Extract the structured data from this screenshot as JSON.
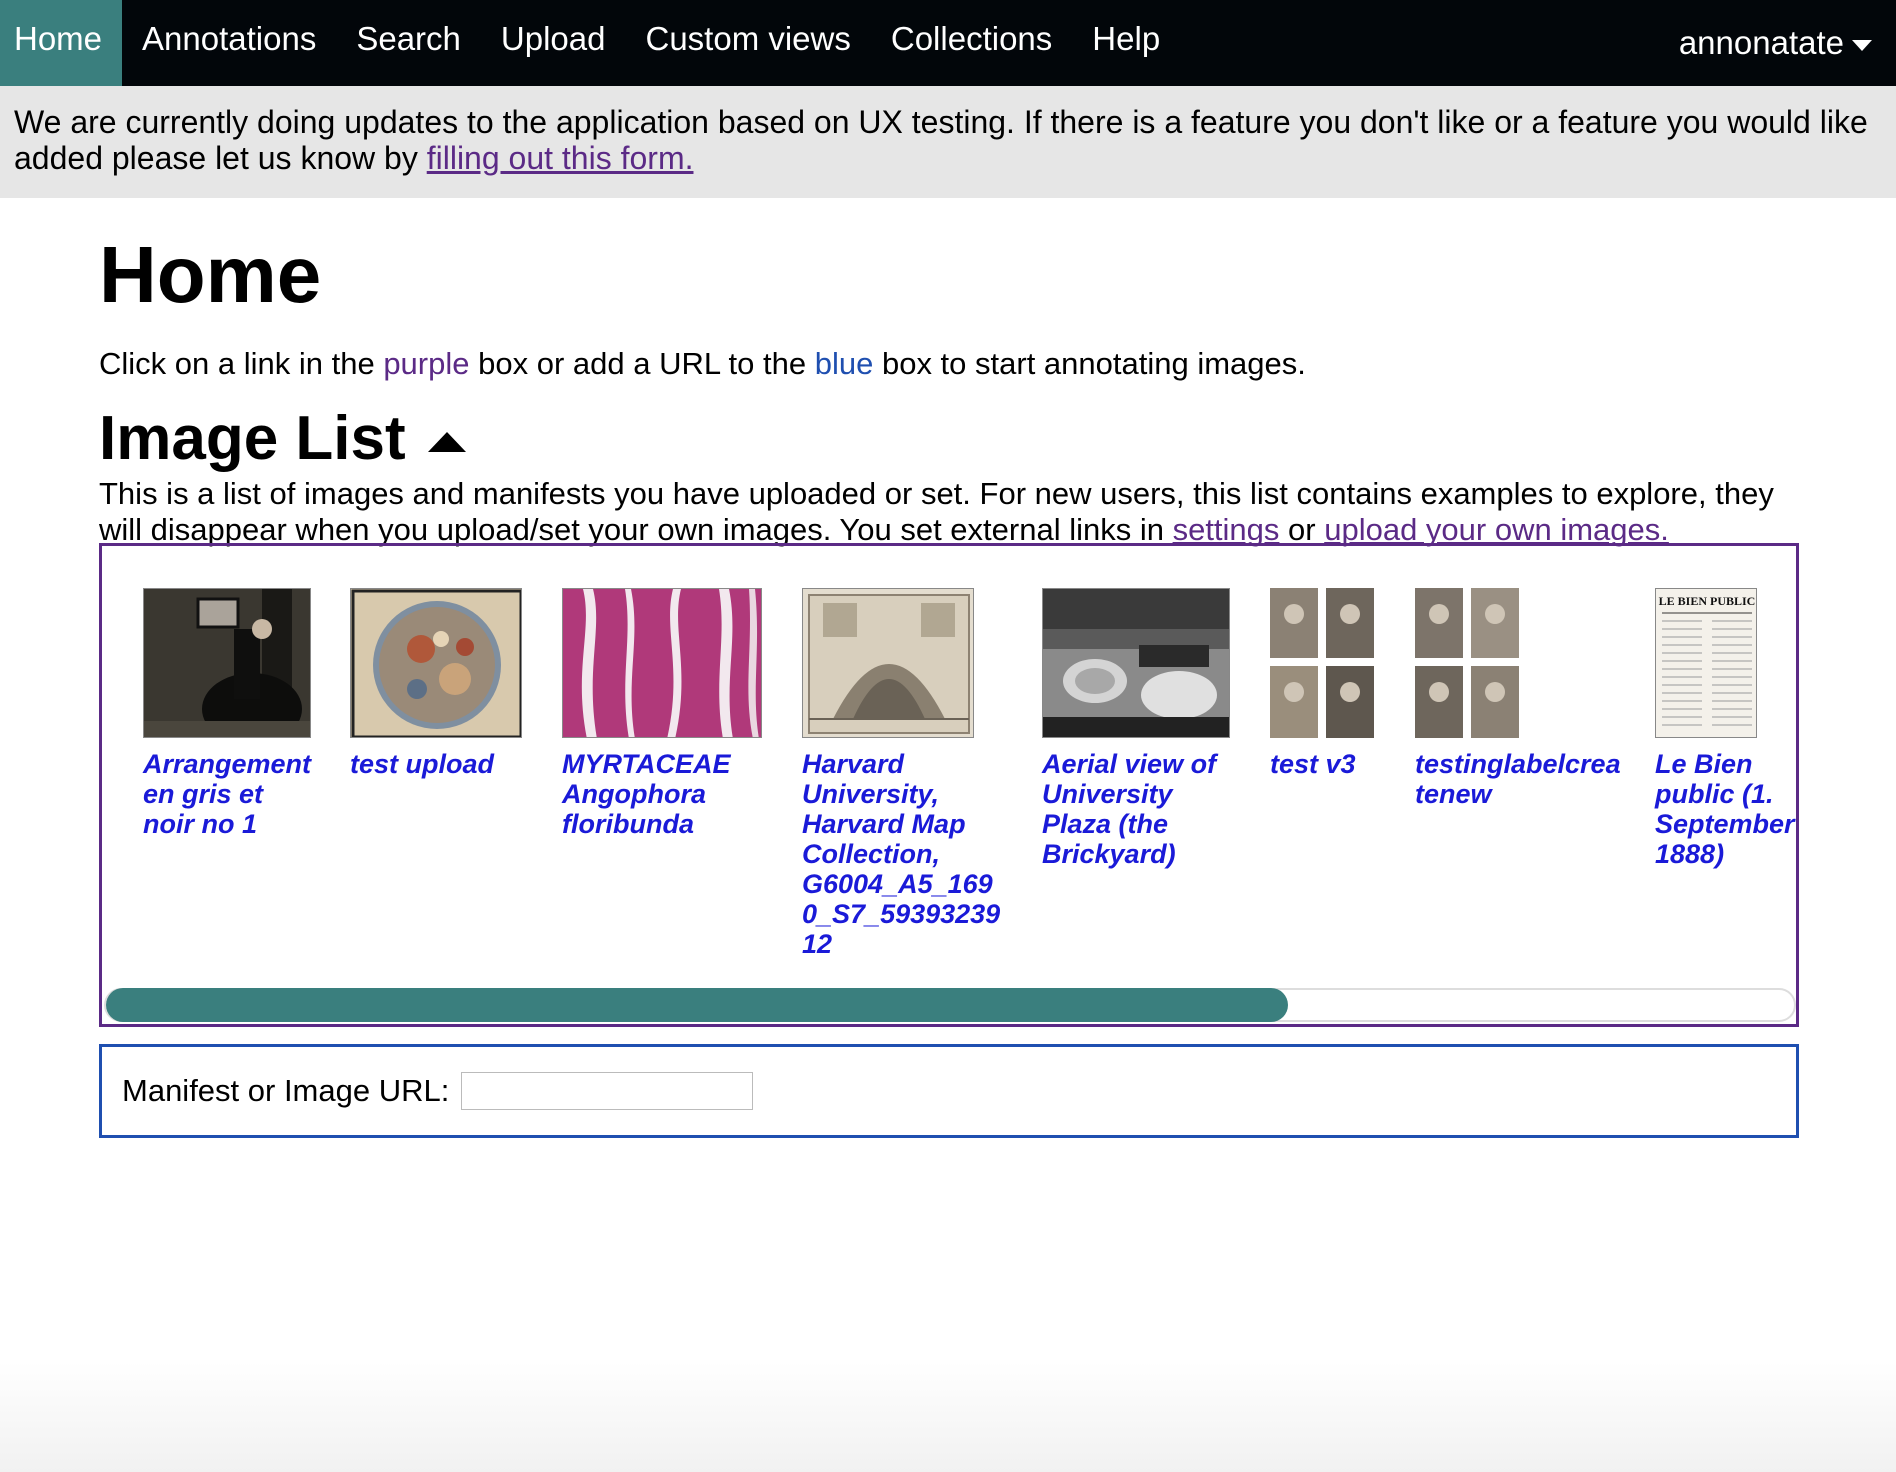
{
  "nav": {
    "items": [
      {
        "label": "Home",
        "active": true
      },
      {
        "label": "Annotations"
      },
      {
        "label": "Search"
      },
      {
        "label": "Upload"
      },
      {
        "label": "Custom views"
      },
      {
        "label": "Collections"
      },
      {
        "label": "Help"
      }
    ],
    "user": "annonatate"
  },
  "banner": {
    "text": "We are currently doing updates to the application based on UX testing. If there is a feature you don't like or a feature you would like added please let us know by ",
    "link": "filling out this form."
  },
  "home": {
    "title": "Home",
    "intro_before": "Click on a link in the ",
    "purple_word": "purple",
    "intro_middle": " box or add a URL to the ",
    "blue_word": "blue",
    "intro_after": " box to start annotating images."
  },
  "image_list": {
    "title": "Image List",
    "desc_before": "This is a list of images and manifests you have uploaded or set. For new users, this list contains examples to explore, they will disappear when you upload/set your own images. You set external links in ",
    "settings_link": "settings",
    "desc_or": " or ",
    "upload_link": "upload your own images.",
    "items": [
      {
        "caption": "Arrangement en gris et noir no 1",
        "icon": "painting-thumbnail"
      },
      {
        "caption": "test upload",
        "icon": "celestial-map-thumbnail"
      },
      {
        "caption": "MYRTACEAE Angophora floribunda",
        "icon": "microscope-slide-thumbnail"
      },
      {
        "caption": "Harvard University, Harvard Map Collection, G6004_A5_1690_S7_5939323912",
        "icon": "city-map-thumbnail"
      },
      {
        "caption": "Aerial view of University Plaza (the Brickyard)",
        "icon": "aerial-photo-thumbnail"
      },
      {
        "caption": "test v3",
        "icon": "photo-grid-thumbnail"
      },
      {
        "caption": "testinglabelcreatenew",
        "icon": "photo-grid-thumbnail"
      },
      {
        "caption": "Le Bien public (1. September 1888)",
        "icon": "newspaper-thumbnail"
      }
    ],
    "scroll_position": 0.7,
    "newspaper_masthead": "LE BIEN PUBLIC"
  },
  "url_box": {
    "label": "Manifest or Image URL:",
    "value": "",
    "placeholder": ""
  },
  "colors": {
    "nav_bg": "#02060a",
    "active_tab": "#3a7f7e",
    "purple": "#5b2a86",
    "blue": "#1f4fb0",
    "caption": "#1a1ad8"
  }
}
